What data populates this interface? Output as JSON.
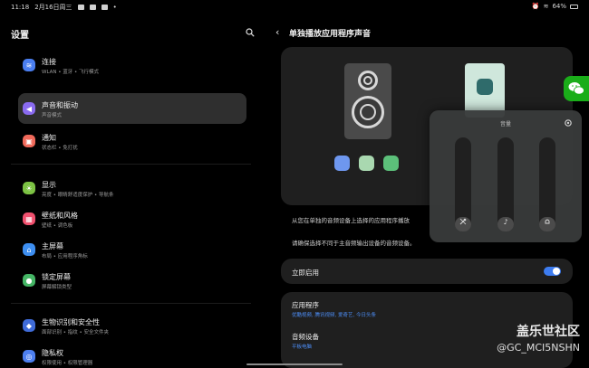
{
  "status_bar": {
    "time": "11:18",
    "date": "2月16日周三",
    "battery": "64%"
  },
  "left": {
    "title": "设置",
    "items": [
      {
        "title": "连接",
        "subtitle": "WLAN • 蓝牙 • 飞行模式",
        "icon": "wifi-icon",
        "color": "#4a7ef0",
        "glyph": "≋"
      },
      {
        "title": "声音和振动",
        "subtitle": "声音模式",
        "icon": "speaker-icon",
        "color": "#8a6bf0",
        "glyph": "◀"
      },
      {
        "title": "通知",
        "subtitle": "状态栏 • 免打扰",
        "icon": "bell-icon",
        "color": "#f0695a",
        "glyph": "▣"
      },
      {
        "title": "显示",
        "subtitle": "亮度 • 眼睛舒适度保护 • 导航条",
        "icon": "sun-icon",
        "color": "#7cc243",
        "glyph": "☀"
      },
      {
        "title": "壁纸和风格",
        "subtitle": "壁纸 • 调色板",
        "icon": "wallpaper-icon",
        "color": "#f0506e",
        "glyph": "▦"
      },
      {
        "title": "主屏幕",
        "subtitle": "布局 • 应用程序角标",
        "icon": "home-icon",
        "color": "#3d8ef0",
        "glyph": "⌂"
      },
      {
        "title": "锁定屏幕",
        "subtitle": "屏幕解锁类型",
        "icon": "lock-icon",
        "color": "#45b565",
        "glyph": "●"
      },
      {
        "title": "生物识别和安全性",
        "subtitle": "面部识别 • 指纹 • 安全文件夹",
        "icon": "shield-icon",
        "color": "#3f6bd8",
        "glyph": "◆"
      },
      {
        "title": "隐私权",
        "subtitle": "权限使用 • 权限管理器",
        "icon": "privacy-icon",
        "color": "#4d7ff0",
        "glyph": "◎"
      }
    ]
  },
  "right": {
    "title": "单独播放应用程序声音",
    "desc1": "从您在单独的音频设备上选择的应用程序播放",
    "desc2": "请确保选择不同于主音频输出设备的音频设备。",
    "toggle_label": "立即启用",
    "toggle_on": true,
    "apps_label": "应用程序",
    "apps_value": "优酷视频, 腾讯视频, 爱奇艺, 今日头条",
    "device_label": "音频设备",
    "device_value": "平板电脑",
    "dots": [
      "#6e97ef",
      "#a9d8b0",
      "#5cc07a"
    ]
  },
  "volume_panel": {
    "title": "音量",
    "sliders": [
      {
        "name": "media-mute-icon",
        "level": 0.15
      },
      {
        "name": "music-note-icon",
        "level": 0.15
      },
      {
        "name": "bell-icon",
        "level": 0.15
      }
    ]
  },
  "watermark": {
    "line1": "盖乐世社区",
    "line2": "@GC_MCI5NSHN"
  }
}
